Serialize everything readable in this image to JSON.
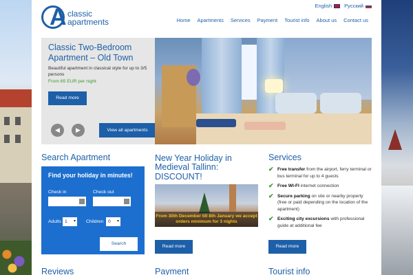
{
  "header": {
    "logo_line1": "classic",
    "logo_line2": "apartments",
    "languages": [
      "English",
      "Русский"
    ],
    "nav": [
      "Home",
      "Apartments",
      "Services",
      "Payment",
      "Tourist info",
      "About us",
      "Contact us"
    ]
  },
  "hero": {
    "title": "Classic Two-Bedroom Apartment – Old Town",
    "description": "Beautiful apartment in classical style for up to 3/5 persons",
    "price": "From 65 EUR per night",
    "read_more": "Read more",
    "prev_icon": "arrow-left-icon",
    "next_icon": "arrow-right-icon",
    "prev_glyph": "◀",
    "next_glyph": "▶",
    "all_apartments": "View all apartments"
  },
  "search": {
    "title": "Search Apartment",
    "heading": "Find your holiday in minutes!",
    "check_in_label": "Check in",
    "check_out_label": "Check out",
    "adults_label": "Adults",
    "adults_value": "1",
    "children_label": "Children",
    "children_value": "0",
    "button": "Search"
  },
  "promo": {
    "title": "New Year Holiday in Medieval Tallinn: DISCOUNT!",
    "banner": "From 30th December till 8th January we accept orders minimum for 3 nights",
    "read_more": "Read more"
  },
  "services": {
    "title": "Services",
    "items": [
      {
        "bold": "Free transfer",
        "text": " from the airport, ferry terminal or bus terminal for up to 4 guests"
      },
      {
        "bold": "Free WI-FI",
        "text": " internet connection"
      },
      {
        "bold": "Secure parking",
        "text": " on site or nearby property (free or paid depending on the location of the apartment)"
      },
      {
        "bold": "Exciting city excursions",
        "text": " with professional guide at additional fee"
      }
    ],
    "read_more": "Read more"
  },
  "bottom": {
    "reviews": "Reviews",
    "payment": "Payment",
    "tourist_info": "Tourist info"
  },
  "colors": {
    "brand_blue": "#1d5fa8",
    "search_box": "#1d6fcf",
    "price_green": "#3a9a2c",
    "promo_banner_text": "#f7c21a"
  }
}
